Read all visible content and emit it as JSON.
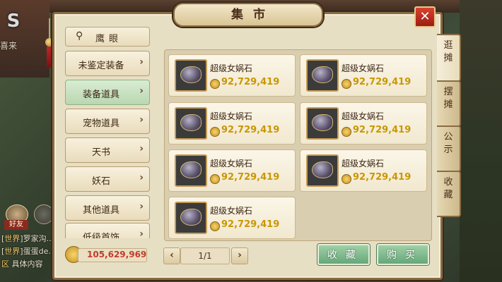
{
  "hud": {
    "left_text": "喜来",
    "friend_label": "好友",
    "chat": [
      {
        "tag": "世界",
        "text": "罗家沟..."
      },
      {
        "tag": "世界",
        "text": "蛋蛋de..."
      },
      {
        "tag": "区",
        "text": "具体内容"
      }
    ]
  },
  "window": {
    "title": "集市",
    "close_label": "✕"
  },
  "sidebar": {
    "search_label": "鹰眼",
    "categories": [
      {
        "label": "未鉴定装备",
        "chevron": "›"
      },
      {
        "label": "装备道具",
        "chevron": "›"
      },
      {
        "label": "宠物道具",
        "chevron": "›"
      },
      {
        "label": "天书",
        "chevron": "›"
      },
      {
        "label": "妖石",
        "chevron": "›"
      },
      {
        "label": "其他道具",
        "chevron": "›"
      },
      {
        "label": "低级首饰",
        "chevron": "›"
      }
    ],
    "active_index": 1
  },
  "items": [
    {
      "name": "超级女娲石",
      "price": "92,729,419"
    },
    {
      "name": "超级女娲石",
      "price": "92,729,419"
    },
    {
      "name": "超级女娲石",
      "price": "92,729,419"
    },
    {
      "name": "超级女娲石",
      "price": "92,729,419"
    },
    {
      "name": "超级女娲石",
      "price": "92,729,419"
    },
    {
      "name": "超级女娲石",
      "price": "92,729,419"
    },
    {
      "name": "超级女娲石",
      "price": "92,729,419"
    }
  ],
  "footer": {
    "money": "105,629,969",
    "page": "1/1",
    "prev": "‹",
    "next": "›",
    "collect_label": "收藏",
    "buy_label": "购买"
  },
  "tabs": [
    {
      "label": [
        "逛",
        "摊"
      ]
    },
    {
      "label": [
        "摆",
        "摊"
      ]
    },
    {
      "label": [
        "公",
        "示"
      ]
    },
    {
      "label": [
        "收",
        "藏"
      ]
    }
  ],
  "colors": {
    "panel_bg": "#e7dfc4",
    "price_gold": "#c99700",
    "money_red": "#c43b2b",
    "active_green": "#b9d7b0",
    "close_red": "#c0321f"
  }
}
